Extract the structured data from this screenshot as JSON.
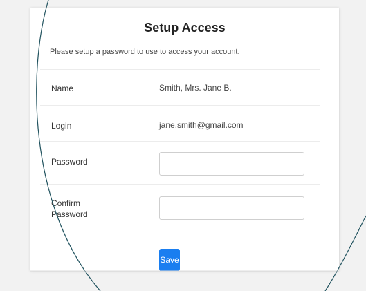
{
  "form": {
    "title": "Setup Access",
    "description": "Please setup a password to use to access your account.",
    "fields": {
      "name": {
        "label": "Name",
        "value": "Smith, Mrs. Jane B."
      },
      "login": {
        "label": "Login",
        "value": "jane.smith@gmail.com"
      },
      "password": {
        "label": "Password",
        "value": ""
      },
      "confirm_password": {
        "label_line1": "Confirm",
        "label_line2": "Password",
        "value": ""
      }
    },
    "save_label": "Save"
  }
}
